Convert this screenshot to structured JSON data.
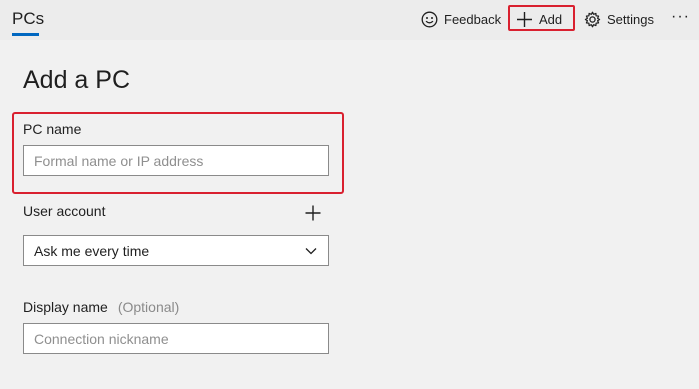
{
  "header": {
    "tab": "PCs",
    "feedback_label": "Feedback",
    "add_label": "Add",
    "settings_label": "Settings",
    "more_label": "···"
  },
  "form": {
    "title": "Add a PC",
    "pc_name_label": "PC name",
    "pc_name_placeholder": "Formal name or IP address",
    "user_account_label": "User account",
    "user_account_value": "Ask me every time",
    "display_name_label": "Display name",
    "display_name_optional": "(Optional)",
    "display_name_placeholder": "Connection nickname"
  },
  "colors": {
    "accent": "#0067c0",
    "highlight": "#d9202f"
  }
}
